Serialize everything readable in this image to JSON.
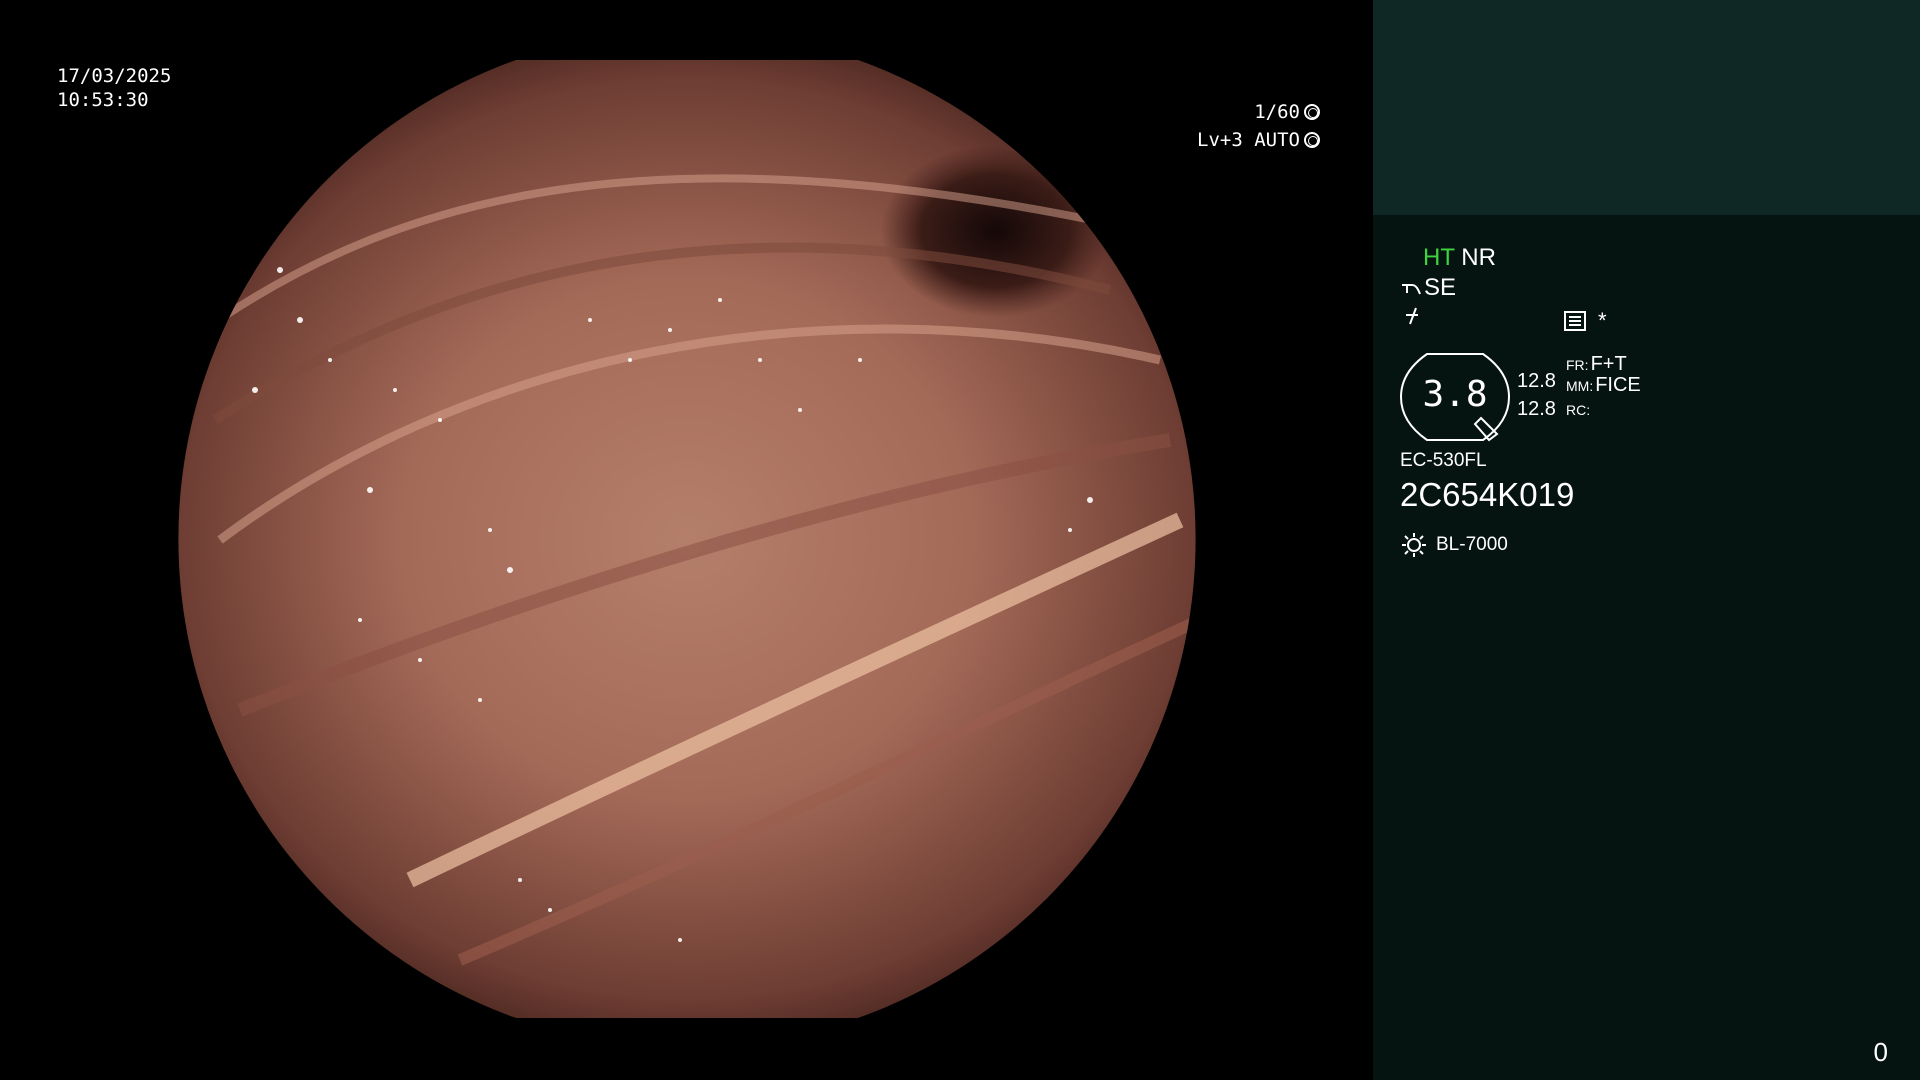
{
  "osd": {
    "date": "17/03/2025",
    "time": "10:53:30",
    "shutter": "1/60",
    "iris": "Lv+3 AUTO"
  },
  "side_panel": {
    "ht": "HT",
    "nr": "NR",
    "se": "SE",
    "asterisk": "*",
    "gauge_value": "3.8",
    "val1": "12.8",
    "val2": "12.8",
    "fr_label": "FR:",
    "fr_value": "F+T",
    "mm_label": "MM:",
    "mm_value": "FICE",
    "rc_label": "RC:",
    "scope_model": "EC-530FL",
    "serial": "2C654K019",
    "light_source": "BL-7000",
    "footer_number": "0"
  },
  "colors": {
    "background": "#000000",
    "panel_dark": "#051311",
    "panel_top": "#0f2725",
    "ht_green": "#3fd43f"
  },
  "icons": [
    "shutter-icon",
    "auto-iris-icon",
    "scope-icon",
    "sharpness-icon",
    "menu-icon",
    "lamp-icon"
  ]
}
